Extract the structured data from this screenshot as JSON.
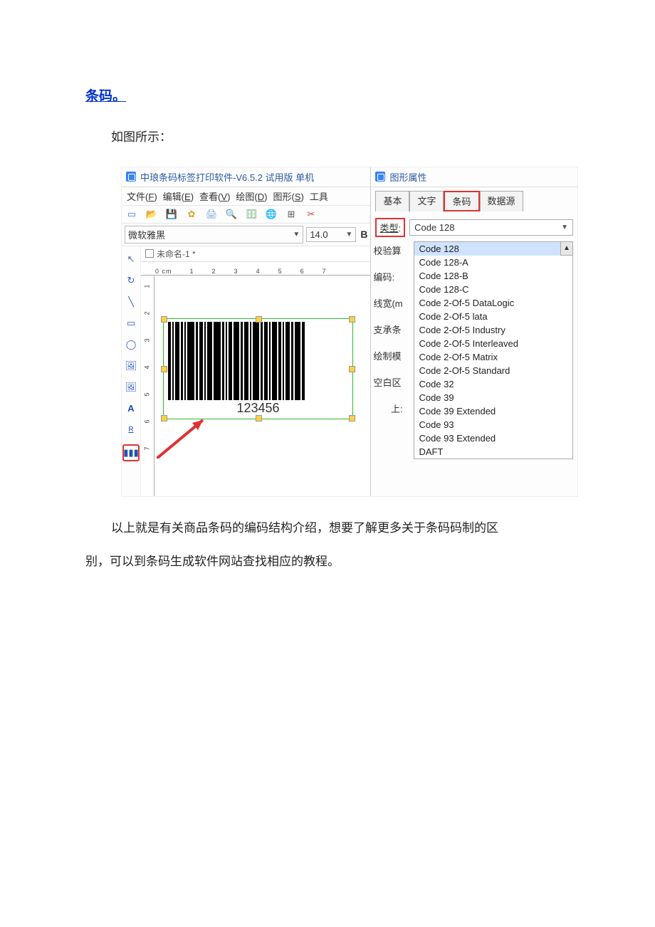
{
  "doc": {
    "heading_link": "条码。",
    "intro": "如图所示：",
    "footer_line1": "以上就是有关商品条码的编码结构介绍，想要了解更多关于条码码制的区",
    "footer_line2": "别，可以到条码生成软件网站查找相应的教程。"
  },
  "app": {
    "title": "中琅条码标签打印软件-V6.5.2 试用版 单机",
    "menus": {
      "file": "文件",
      "file_key": "F",
      "edit": "编辑",
      "edit_key": "E",
      "view": "查看",
      "view_key": "V",
      "draw": "绘图",
      "draw_key": "D",
      "shape": "图形",
      "shape_key": "S",
      "tool": "工具"
    },
    "font_name": "微软雅黑",
    "font_size": "14.0",
    "bold": "B",
    "tab_name": "未命名-1 *",
    "ruler_marks": [
      "0 cm",
      "1",
      "2",
      "3",
      "4",
      "5",
      "6",
      "7"
    ],
    "ruler_v": [
      "1",
      "2",
      "3",
      "4",
      "5",
      "6",
      "7"
    ],
    "barcode_value": "123456",
    "tool_text": "A",
    "tool_align": "R"
  },
  "props": {
    "panel_title": "图形属性",
    "tabs": {
      "basic": "基本",
      "text": "文字",
      "barcode": "条码",
      "datasource": "数据源"
    },
    "type_label": "类型",
    "type_colon": ":",
    "type_value": "Code 128",
    "side_labels": {
      "checksum": "校验算",
      "encoding": "编码:",
      "linewidth": "线宽(m",
      "support": "支承条",
      "drawmode": "绘制模",
      "blank": "空白区",
      "top": "上:"
    },
    "options": [
      "Code 128",
      "Code 128-A",
      "Code 128-B",
      "Code 128-C",
      "Code 2-Of-5 DataLogic",
      "Code 2-Of-5 lata",
      "Code 2-Of-5 Industry",
      "Code 2-Of-5 Interleaved",
      "Code 2-Of-5 Matrix",
      "Code 2-Of-5 Standard",
      "Code 32",
      "Code 39",
      "Code 39 Extended",
      "Code 93",
      "Code 93 Extended",
      "DAFT"
    ]
  }
}
